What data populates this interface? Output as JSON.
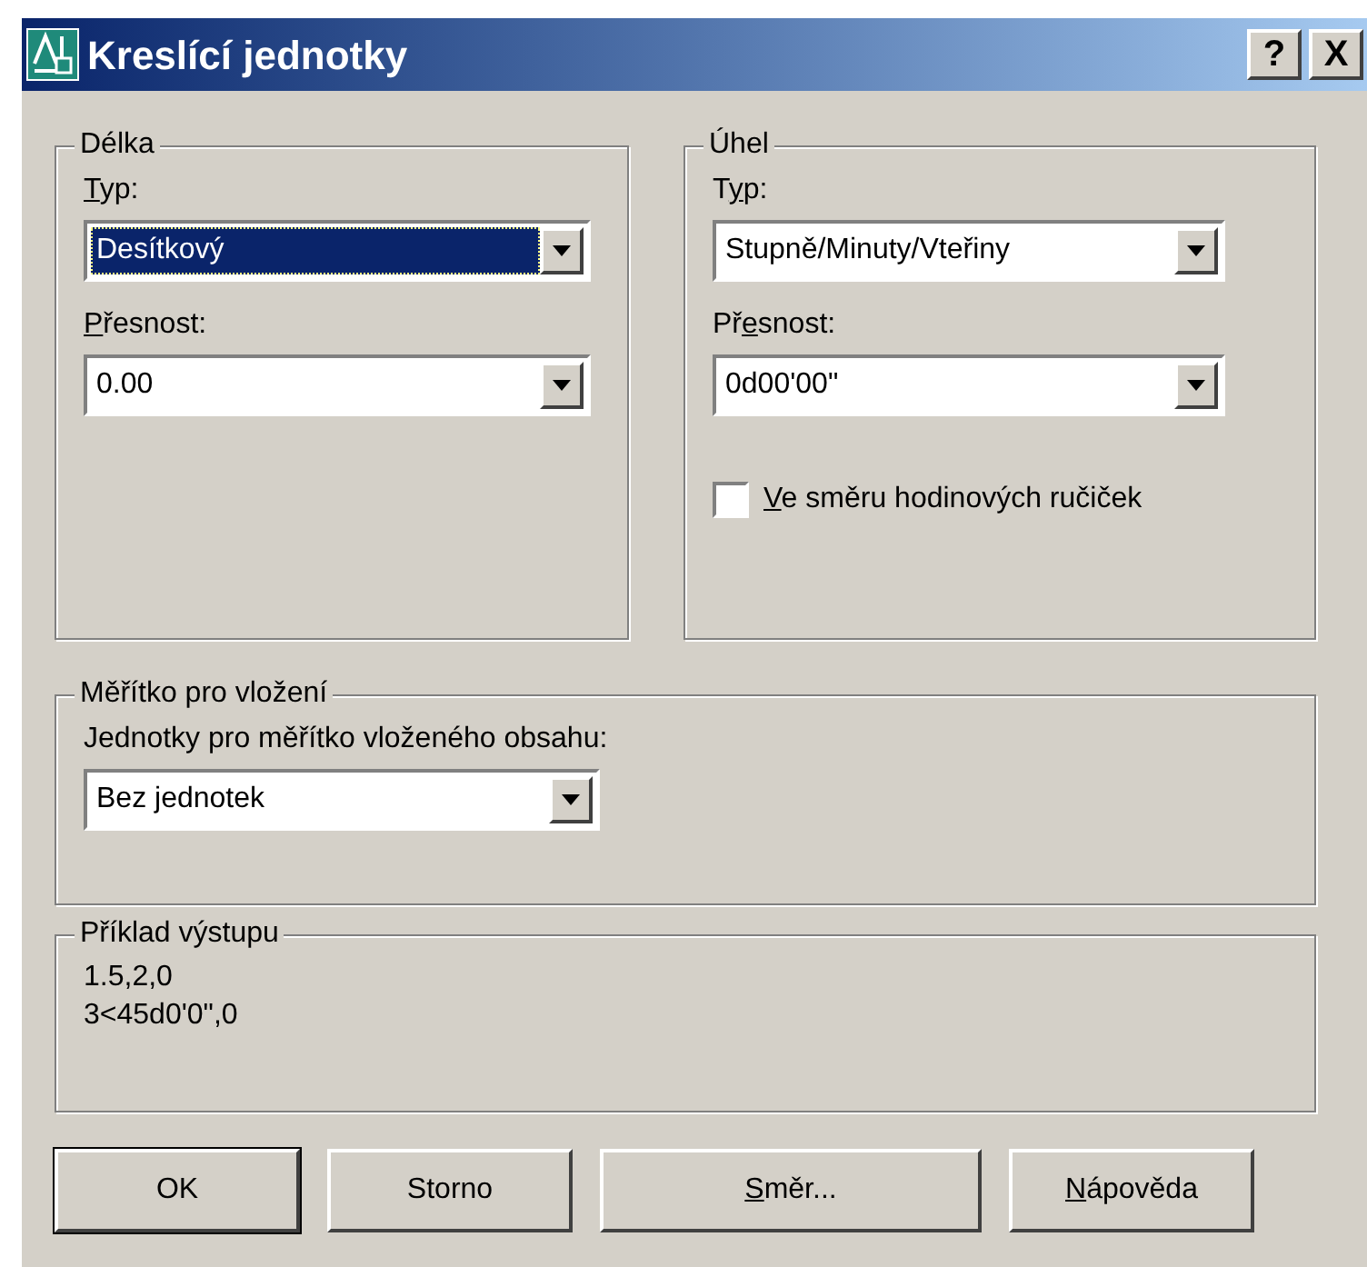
{
  "window": {
    "title": "Kreslící jednotky",
    "title_buttons": [
      "?",
      "X"
    ]
  },
  "length_group": {
    "title": "Délka",
    "type_label": [
      {
        "text": "T",
        "underlined": true
      },
      {
        "text": "yp:",
        "underlined": false
      }
    ],
    "type_value": "Desítkový",
    "type_focused": true,
    "precision_label": [
      {
        "text": "P",
        "underlined": true
      },
      {
        "text": "řesnost:",
        "underlined": false
      }
    ],
    "precision_value": "0.00"
  },
  "angle_group": {
    "title": "Úhel",
    "type_label": [
      {
        "text": "T",
        "underlined": false
      },
      {
        "text": "y",
        "underlined": true
      },
      {
        "text": "p:",
        "underlined": false
      }
    ],
    "type_value": "Stupně/Minuty/Vteřiny",
    "type_focused": false,
    "precision_label": [
      {
        "text": "Př",
        "underlined": false
      },
      {
        "text": "e",
        "underlined": true
      },
      {
        "text": "snost:",
        "underlined": false
      }
    ],
    "precision_value": "0d00'00\"",
    "clockwise": {
      "label": [
        {
          "text": "V",
          "underlined": true
        },
        {
          "text": "e směru hodinových ručiček",
          "underlined": false
        }
      ],
      "checked": false
    }
  },
  "insert_scale": {
    "title": "Měřítko pro vložení",
    "label": "Jednotky pro měřítko vloženého obsahu:",
    "value": "Bez jednotek"
  },
  "sample_output": {
    "title": "Příklad výstupu",
    "lines": [
      "1.5,2,0",
      "3<45d0'0\",0"
    ]
  },
  "buttons": [
    {
      "label": [
        {
          "text": "OK",
          "underlined": false
        }
      ],
      "default": true
    },
    {
      "label": [
        {
          "text": "Storno",
          "underlined": false
        }
      ],
      "default": false
    },
    {
      "label": [
        {
          "text": "S",
          "underlined": true
        },
        {
          "text": "měr...",
          "underlined": false
        }
      ],
      "default": false
    },
    {
      "label": [
        {
          "text": "N",
          "underlined": true
        },
        {
          "text": "ápověda",
          "underlined": false
        }
      ],
      "default": false
    }
  ]
}
